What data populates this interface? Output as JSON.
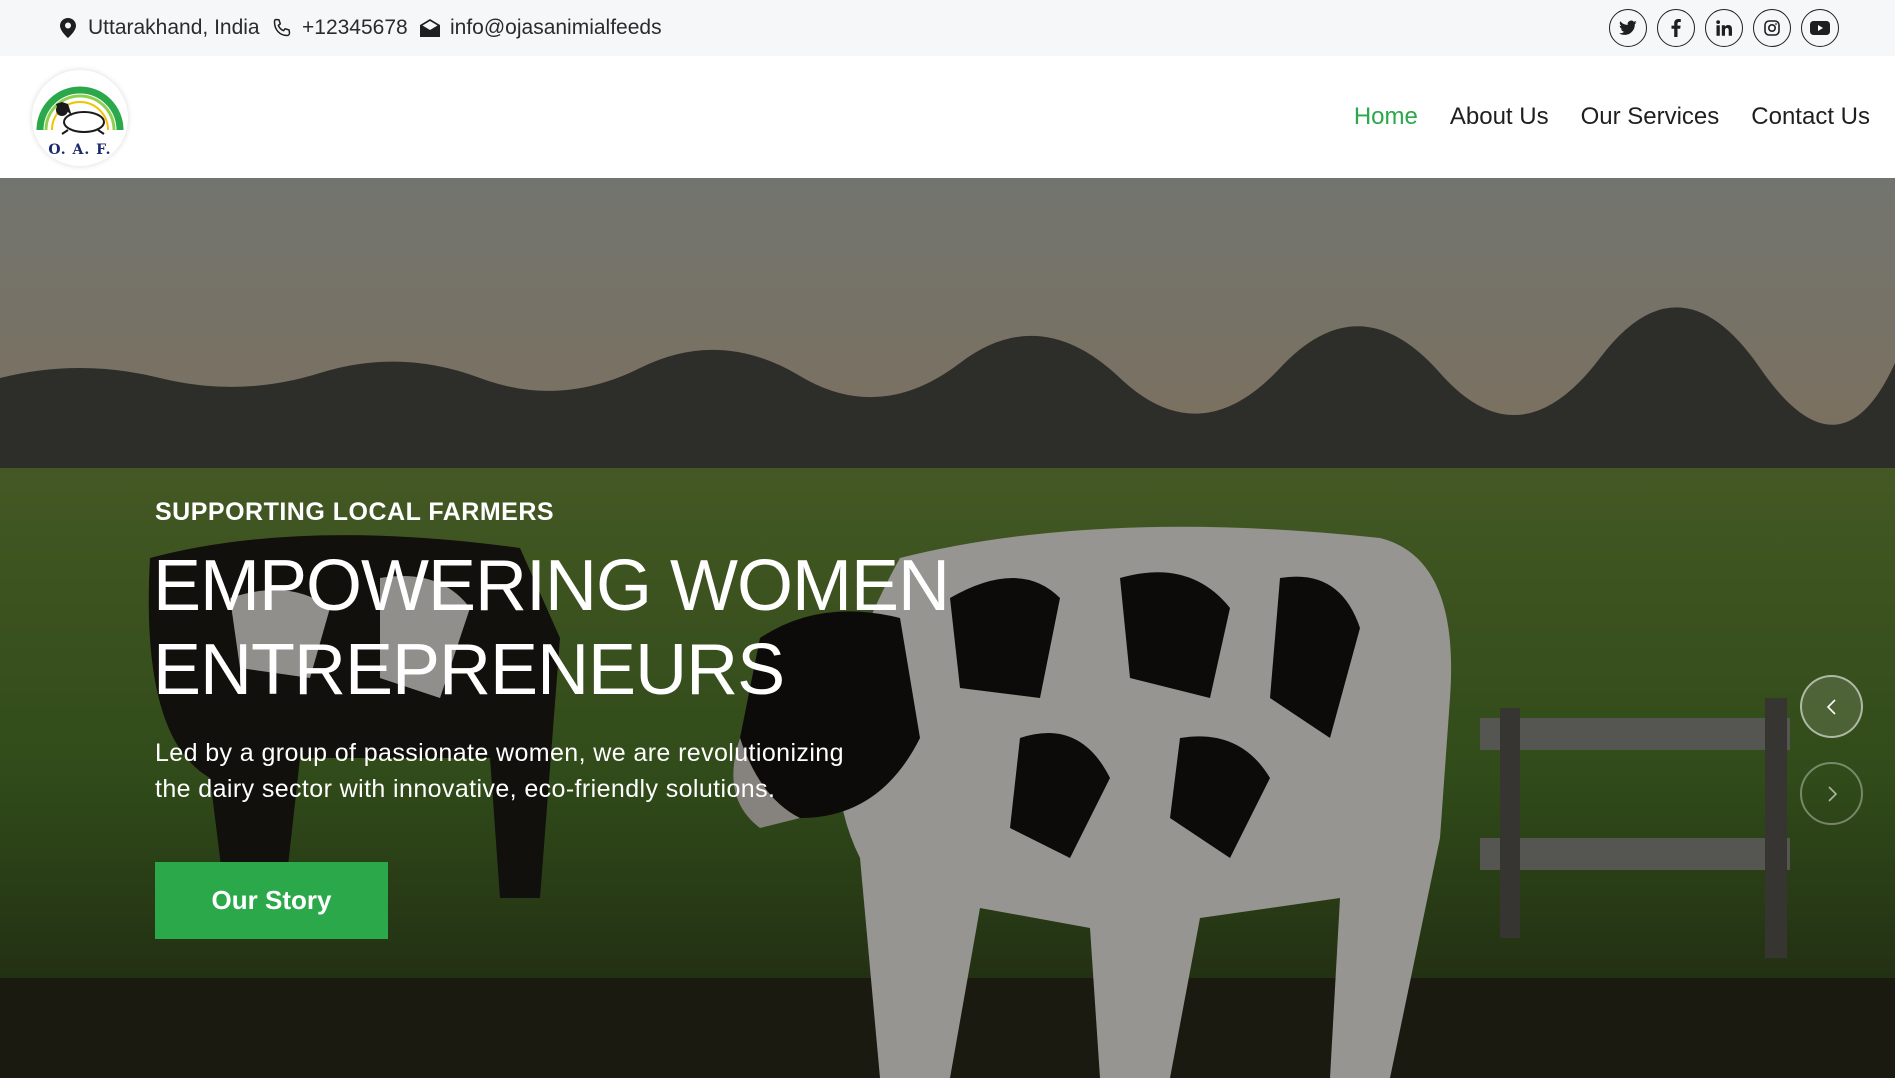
{
  "topbar": {
    "location": "Uttarakhand, India",
    "phone": "+12345678",
    "email": "info@ojasanimialfeeds",
    "socials": [
      "twitter-icon",
      "facebook-icon",
      "linkedin-icon",
      "instagram-icon",
      "youtube-icon"
    ]
  },
  "brand": {
    "logo_text": "O. A. F."
  },
  "nav": {
    "items": [
      {
        "label": "Home",
        "active": true
      },
      {
        "label": "About Us",
        "active": false
      },
      {
        "label": "Our Services",
        "active": false
      },
      {
        "label": "Contact Us",
        "active": false
      }
    ]
  },
  "hero": {
    "eyebrow": "SUPPORTING LOCAL FARMERS",
    "headline_line1": "EMPOWERING WOMEN",
    "headline_line2": "ENTREPRENEURS",
    "description_line1": "Led by a group of passionate women, we are revolutionizing",
    "description_line2": "the dairy sector with innovative, eco-friendly solutions.",
    "cta_label": "Our Story"
  },
  "colors": {
    "accent": "#2aa84a",
    "topbar_bg": "#f6f7f9",
    "text_dark": "#1f1f1f"
  }
}
